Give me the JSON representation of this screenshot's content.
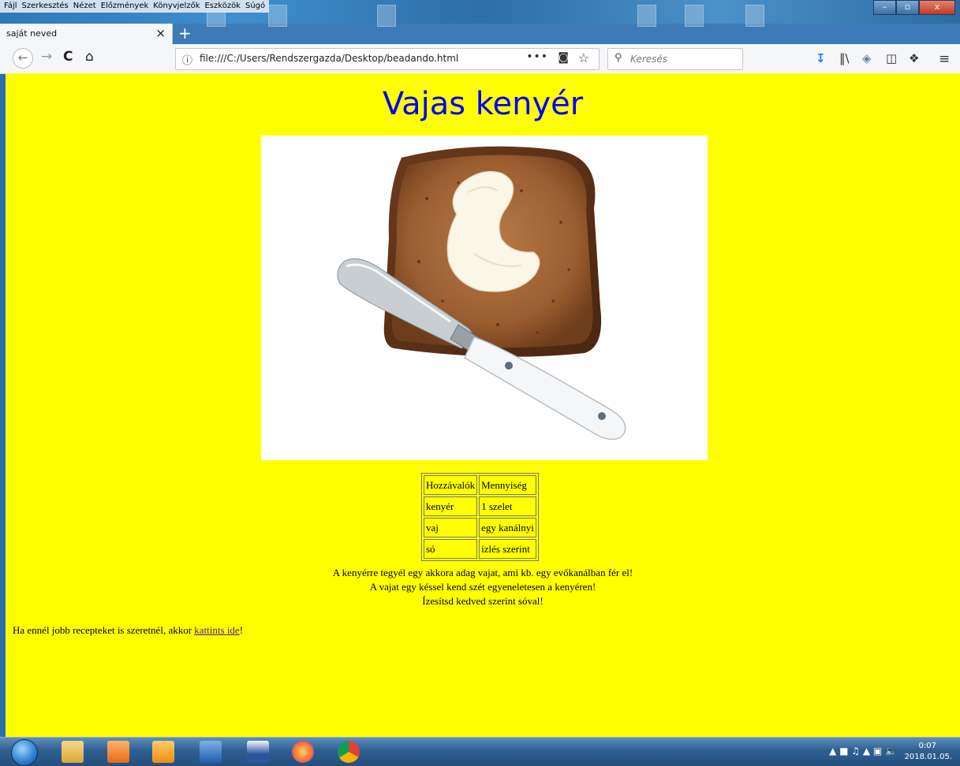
{
  "menu": [
    "Fájl",
    "Szerkesztés",
    "Nézet",
    "Előzmények",
    "Könyvjelzők",
    "Eszközök",
    "Súgó"
  ],
  "window_controls": {
    "minimize": "–",
    "maximize": "▫",
    "close": "x"
  },
  "tab": {
    "title": "saját neved",
    "close": "×",
    "new_tab": "+"
  },
  "nav": {
    "back": "←",
    "forward": "→",
    "reload": "C",
    "home": "⌂",
    "url": "file:///C:/Users/Rendszergazda/Desktop/beadando.html",
    "info_icon": "ⓘ",
    "page_actions": "•••",
    "pocket": "◙",
    "bookmark": "☆",
    "search_placeholder": "Keresés",
    "toolbar_icons": [
      "downloads-icon",
      "library-icon",
      "extension-icon",
      "sidebar-icon",
      "screenshot-icon",
      "menu-icon"
    ]
  },
  "page": {
    "heading": "Vajas kenyér",
    "image_alt": "vajas kenyér kép",
    "table": {
      "headers": [
        "Hozzávalók",
        "Mennyiség"
      ],
      "rows": [
        [
          "kenyér",
          "1 szelet"
        ],
        [
          "vaj",
          "egy kanálnyi"
        ],
        [
          "só",
          "ízlés szerint"
        ]
      ]
    },
    "instructions": [
      "A kenyérre tegyél egy akkora adag vajat, ami kb. egy evőkanálban fér el!",
      "A vajat egy késsel kend szét egyeneletesen a kenyéren!",
      "Ízesítsd kedved szerint sóval!"
    ],
    "footer": {
      "before": "Ha ennél jobb recepteket is szeretnél, akkor ",
      "link": "kattints ide",
      "after": "!"
    },
    "background": "#ffff00",
    "heading_color": "#0000ff"
  },
  "taskbar": {
    "icons": [
      "start-orb",
      "explorer-icon",
      "media-player-icon",
      "outlook-icon",
      "save-icon",
      "word-icon",
      "firefox-icon",
      "chrome-icon"
    ],
    "clock_time": "0:07",
    "clock_date": "2018.01.05."
  }
}
